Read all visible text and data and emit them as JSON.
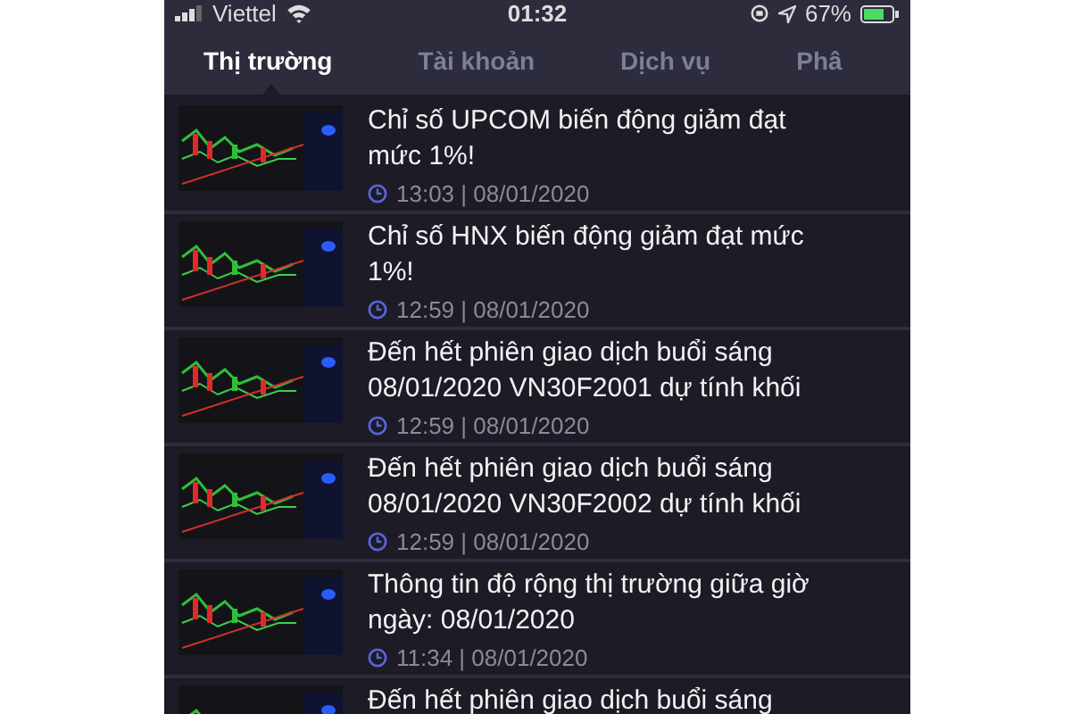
{
  "status_bar": {
    "carrier": "Viettel",
    "time": "01:32",
    "battery": "67%"
  },
  "tabs": [
    {
      "label": "Thị trường",
      "selected": true
    },
    {
      "label": "Tài khoản",
      "selected": false
    },
    {
      "label": "Dịch vụ",
      "selected": false
    },
    {
      "label": "Phâ",
      "selected": false
    }
  ],
  "news": [
    {
      "title": "Chỉ số UPCOM biến động giảm đạt mức 1%!",
      "time": "13:03 | 08/01/2020"
    },
    {
      "title": "Chỉ số HNX biến động giảm đạt mức 1%!",
      "time": "12:59 | 08/01/2020"
    },
    {
      "title": "Đến hết phiên giao dịch buổi sáng 08/01/2020 VN30F2001 dự tính khối",
      "time": "12:59 | 08/01/2020"
    },
    {
      "title": "Đến hết phiên giao dịch buổi sáng 08/01/2020 VN30F2002 dự tính khối",
      "time": "12:59 | 08/01/2020"
    },
    {
      "title": "Thông tin độ rộng thị trường giữa giờ ngày: 08/01/2020",
      "time": "11:34 | 08/01/2020"
    },
    {
      "title": "Đến hết phiên giao dịch buổi sáng"
    }
  ]
}
